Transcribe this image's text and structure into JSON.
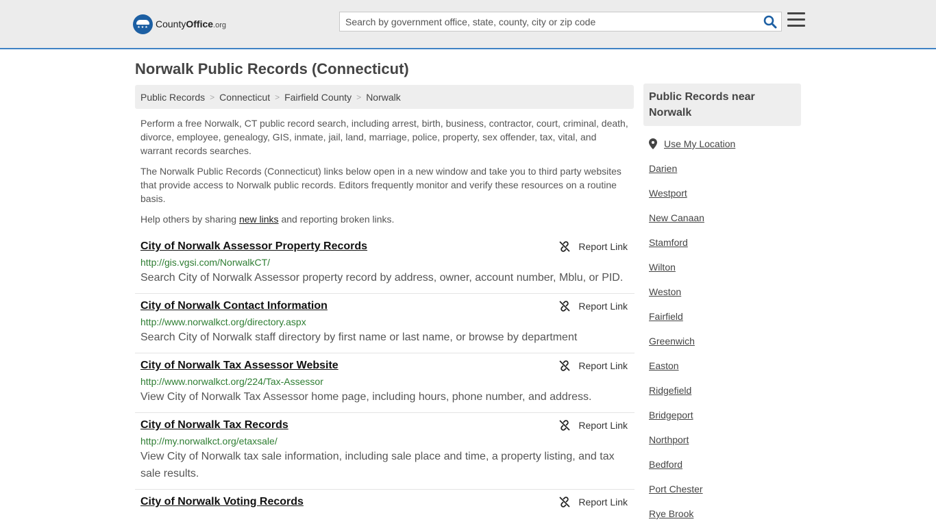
{
  "header": {
    "logo": {
      "brand_a": "County",
      "brand_b": "Office",
      "tld": ".org"
    },
    "search_placeholder": "Search by government office, state, county, city or zip code",
    "icons": {
      "search": "search-icon",
      "menu": "hamburger-menu-icon"
    }
  },
  "page": {
    "title": "Norwalk Public Records (Connecticut)"
  },
  "breadcrumb": [
    "Public Records",
    "Connecticut",
    "Fairfield County",
    "Norwalk"
  ],
  "intro": {
    "p1": "Perform a free Norwalk, CT public record search, including arrest, birth, business, contractor, court, criminal, death, divorce, employee, genealogy, GIS, inmate, jail, land, marriage, police, property, sex offender, tax, vital, and warrant records searches.",
    "p2": "The Norwalk Public Records (Connecticut) links below open in a new window and take you to third party websites that provide access to Norwalk public records. Editors frequently monitor and verify these resources on a routine basis.",
    "p3_before": "Help others by sharing ",
    "p3_link": "new links",
    "p3_after": " and reporting broken links."
  },
  "report_label": "Report Link",
  "records": [
    {
      "title": "City of Norwalk Assessor Property Records",
      "url": "http://gis.vgsi.com/NorwalkCT/",
      "desc": "Search City of Norwalk Assessor property record by address, owner, account number, Mblu, or PID."
    },
    {
      "title": "City of Norwalk Contact Information",
      "url": "http://www.norwalkct.org/directory.aspx",
      "desc": "Search City of Norwalk staff directory by first name or last name, or browse by department"
    },
    {
      "title": "City of Norwalk Tax Assessor Website",
      "url": "http://www.norwalkct.org/224/Tax-Assessor",
      "desc": "View City of Norwalk Tax Assessor home page, including hours, phone number, and address."
    },
    {
      "title": "City of Norwalk Tax Records",
      "url": "http://my.norwalkct.org/etaxsale/",
      "desc": "View City of Norwalk tax sale information, including sale place and time, a property listing, and tax sale results."
    },
    {
      "title": "City of Norwalk Voting Records",
      "url": "",
      "desc": ""
    }
  ],
  "sidebar": {
    "heading": "Public Records near Norwalk",
    "use_location": "Use My Location",
    "nearby": [
      "Darien",
      "Westport",
      "New Canaan",
      "Stamford",
      "Wilton",
      "Weston",
      "Fairfield",
      "Greenwich",
      "Easton",
      "Ridgefield",
      "Bridgeport",
      "Northport",
      "Bedford",
      "Port Chester",
      "Rye Brook"
    ]
  },
  "colors": {
    "accent": "#3f82c4",
    "logo": "#1c5fa3",
    "url_green": "#2e7d32",
    "header_bg": "#ececec"
  }
}
